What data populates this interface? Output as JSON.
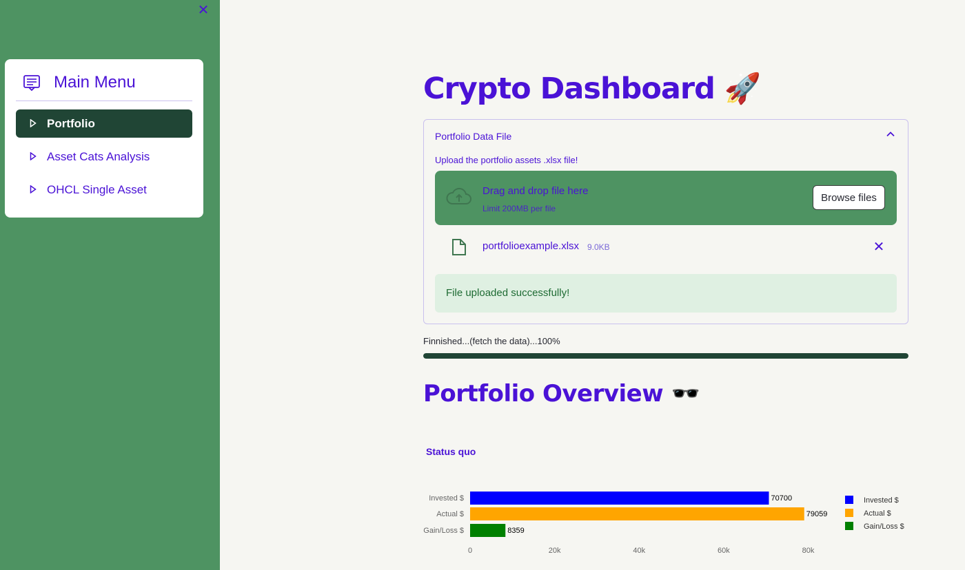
{
  "sidebar": {
    "close_glyph": "✕",
    "menu_title": "Main Menu",
    "menu_icon": "menu-card-icon",
    "items": [
      {
        "label": "Portfolio",
        "active": true
      },
      {
        "label": "Asset Cats Analysis",
        "active": false
      },
      {
        "label": "OHCL Single Asset",
        "active": false
      }
    ]
  },
  "main": {
    "title": "Crypto Dashboard 🚀",
    "expander": {
      "title": "Portfolio Data File",
      "upload_label": "Upload the portfolio assets .xlsx file!",
      "dropzone_text": "Drag and drop file here",
      "dropzone_limit": "Limit 200MB per file",
      "browse_label": "Browse files",
      "file_name": "portfolioexample.xlsx",
      "file_size": "9.0KB",
      "remove_glyph": "✕",
      "success_message": "File uploaded successfully!"
    },
    "progress": {
      "text": "Finnished...(fetch the data)...100%",
      "value": 1.0
    },
    "section_title": "Portfolio Overview 🕶️"
  },
  "colors": {
    "accent": "#4a12d6",
    "sidebar_bg": "#4e9362",
    "active_item": "#204535"
  },
  "chart_data": {
    "type": "bar",
    "orientation": "horizontal",
    "title": "Status quo",
    "categories": [
      "Invested $",
      "Actual $",
      "Gain/Loss $"
    ],
    "values": [
      70700,
      79059,
      8359
    ],
    "colors": [
      "#0000ff",
      "#ffa500",
      "#008000"
    ],
    "xlim": [
      0,
      80000
    ],
    "xticks": [
      0,
      20000,
      40000,
      60000,
      80000
    ],
    "xtick_labels": [
      "0",
      "20k",
      "40k",
      "60k",
      "80k"
    ],
    "legend": [
      "Invested $",
      "Actual $",
      "Gain/Loss $"
    ],
    "legend_position": "right",
    "grid": false
  }
}
